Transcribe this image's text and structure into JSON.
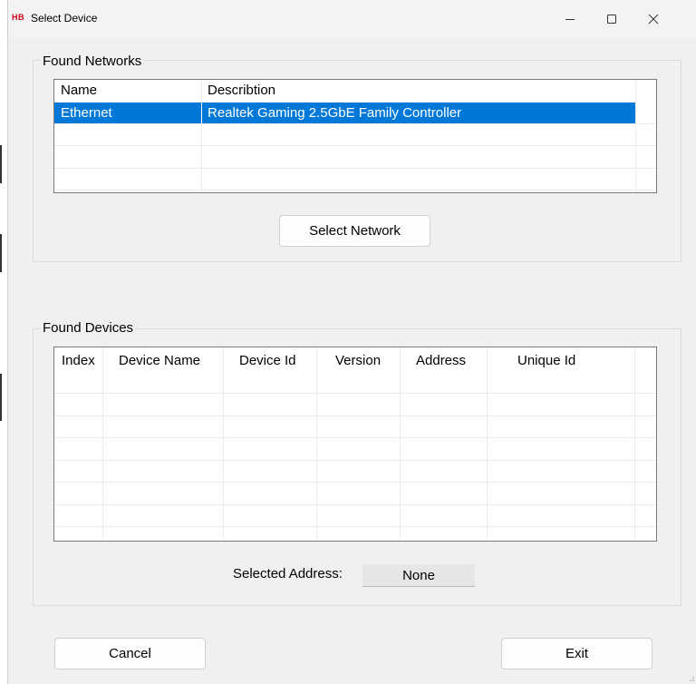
{
  "window": {
    "title": "Select Device",
    "app_icon_text": "HB",
    "controls": {
      "minimize": "minimize-icon",
      "maximize": "maximize-icon",
      "close": "close-icon"
    }
  },
  "networks": {
    "group_label": "Found Networks",
    "columns": [
      "Name",
      "Describtion"
    ],
    "rows": [
      {
        "name": "Ethernet",
        "description": "Realtek Gaming 2.5GbE Family Controller",
        "selected": true
      }
    ],
    "select_button": "Select Network",
    "selection_color": "#0078d7"
  },
  "devices": {
    "group_label": "Found Devices",
    "columns": [
      "Index",
      "Device Name",
      "Device Id",
      "Version",
      "Address",
      "Unique Id"
    ],
    "rows": [],
    "selected_address_label": "Selected Address:",
    "selected_address_value": "None"
  },
  "footer": {
    "cancel_button": "Cancel",
    "exit_button": "Exit"
  }
}
